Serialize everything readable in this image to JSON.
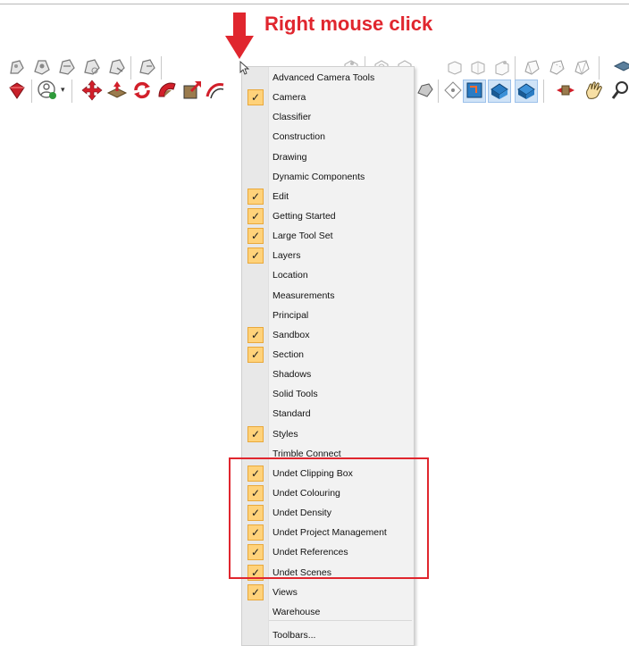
{
  "annotation": {
    "title": "Right mouse click",
    "accent_color": "#e0262e"
  },
  "toolbars": {
    "row1_icons": [
      "walk-icon",
      "look-around-icon",
      "position-camera-icon",
      "zoom-window-icon",
      "previous-view-icon",
      "next-view-icon",
      "iso-view-icon",
      "top-view-icon",
      "front-view-icon",
      "right-view-icon",
      "back-view-icon",
      "left-view-icon",
      "xray-icon",
      "back-edges-icon",
      "wireframe-icon",
      "display-style-icon"
    ],
    "row2_icons": [
      "ruby-console-icon",
      "user-account-icon",
      "move-icon",
      "push-pull-icon",
      "rotate-icon",
      "follow-me-icon",
      "scale-icon",
      "offset-icon",
      "tape-measure-icon",
      "orbit-icon",
      "section-plane-icon",
      "display-section-planes-icon",
      "display-section-cuts-icon",
      "solid-intersect-icon",
      "pan-icon",
      "zoom-icon"
    ]
  },
  "context_menu": {
    "items": [
      {
        "label": "Advanced Camera Tools",
        "checked": false
      },
      {
        "label": "Camera",
        "checked": true
      },
      {
        "label": "Classifier",
        "checked": false
      },
      {
        "label": "Construction",
        "checked": false
      },
      {
        "label": "Drawing",
        "checked": false
      },
      {
        "label": "Dynamic Components",
        "checked": false
      },
      {
        "label": "Edit",
        "checked": true
      },
      {
        "label": "Getting Started",
        "checked": true
      },
      {
        "label": "Large Tool Set",
        "checked": true
      },
      {
        "label": "Layers",
        "checked": true
      },
      {
        "label": "Location",
        "checked": false
      },
      {
        "label": "Measurements",
        "checked": false
      },
      {
        "label": "Principal",
        "checked": false
      },
      {
        "label": "Sandbox",
        "checked": true
      },
      {
        "label": "Section",
        "checked": true
      },
      {
        "label": "Shadows",
        "checked": false
      },
      {
        "label": "Solid Tools",
        "checked": false
      },
      {
        "label": "Standard",
        "checked": false
      },
      {
        "label": "Styles",
        "checked": true
      },
      {
        "label": "Trimble Connect",
        "checked": false
      },
      {
        "label": "Undet Clipping Box",
        "checked": true
      },
      {
        "label": "Undet Colouring",
        "checked": true
      },
      {
        "label": "Undet Density",
        "checked": true
      },
      {
        "label": "Undet Project Management",
        "checked": true
      },
      {
        "label": "Undet References",
        "checked": true
      },
      {
        "label": "Undet Scenes",
        "checked": true
      },
      {
        "label": "Views",
        "checked": true
      },
      {
        "label": "Warehouse",
        "checked": false
      },
      {
        "label": "Toolbars...",
        "checked": false
      }
    ],
    "check_glyph": "✓",
    "check_color": "#ffd27a"
  }
}
